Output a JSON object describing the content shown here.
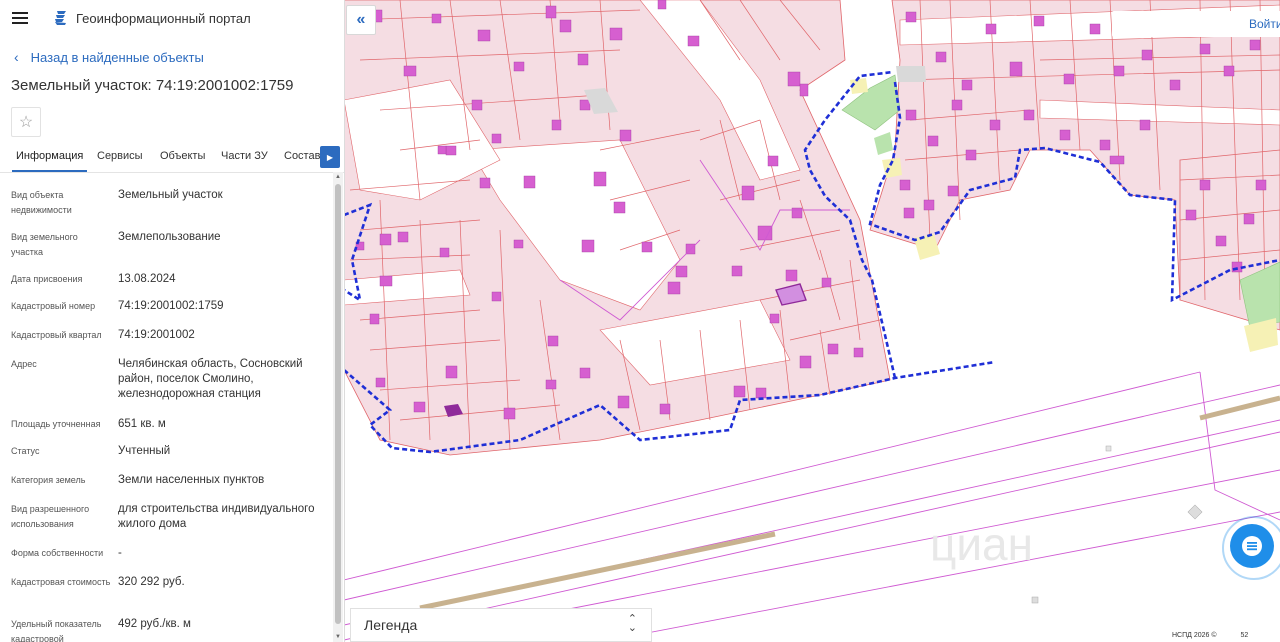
{
  "header": {
    "portal_title": "Геоинформационный портал"
  },
  "nav": {
    "back_label": "Назад в найденные объекты"
  },
  "object": {
    "title": "Земельный участок: 74:19:2001002:1759"
  },
  "tabs": [
    {
      "label": "Информация",
      "active": true
    },
    {
      "label": "Сервисы",
      "active": false
    },
    {
      "label": "Объекты",
      "active": false
    },
    {
      "label": "Части ЗУ",
      "active": false
    },
    {
      "label": "Состав",
      "active": false
    }
  ],
  "properties": [
    {
      "label": "Вид объекта недвижимости",
      "value": "Земельный участок"
    },
    {
      "label": "Вид земельного участка",
      "value": "Землепользование"
    },
    {
      "label": "Дата присвоения",
      "value": "13.08.2024"
    },
    {
      "label": "Кадастровый номер",
      "value": "74:19:2001002:1759"
    },
    {
      "label": "Кадастровый квартал",
      "value": "74:19:2001002"
    },
    {
      "label": "Адрес",
      "value": "Челябинская область, Сосновский район, поселок Смолино, железнодорожная станция"
    },
    {
      "label": "Площадь уточненная",
      "value": "651 кв. м"
    },
    {
      "label": "Статус",
      "value": "Учтенный"
    },
    {
      "label": "Категория земель",
      "value": "Земли населенных пунктов"
    },
    {
      "label": "Вид разрешенного использования",
      "value": "для строительства индивидуального жилого дома"
    },
    {
      "label": "Форма собственности",
      "value": "-"
    },
    {
      "label": "Кадастровая стоимость",
      "value": "320 292 руб."
    },
    {
      "label": "Удельный показатель кадастровой",
      "value": "492 руб./кв. м"
    }
  ],
  "map": {
    "login_label": "Войти",
    "legend_label": "Легенда",
    "copyright": "НСПД 2026 ©",
    "scale_fragment": "52",
    "colors": {
      "parcel_fill": "#f5dde3",
      "parcel_border": "#e0656a",
      "building_fill": "#d65fd0",
      "boundary": "#1f2fd6",
      "rail": "#cf5ad2",
      "green_zone": "#b9e3ad",
      "accent": "#2c6bbf"
    }
  }
}
